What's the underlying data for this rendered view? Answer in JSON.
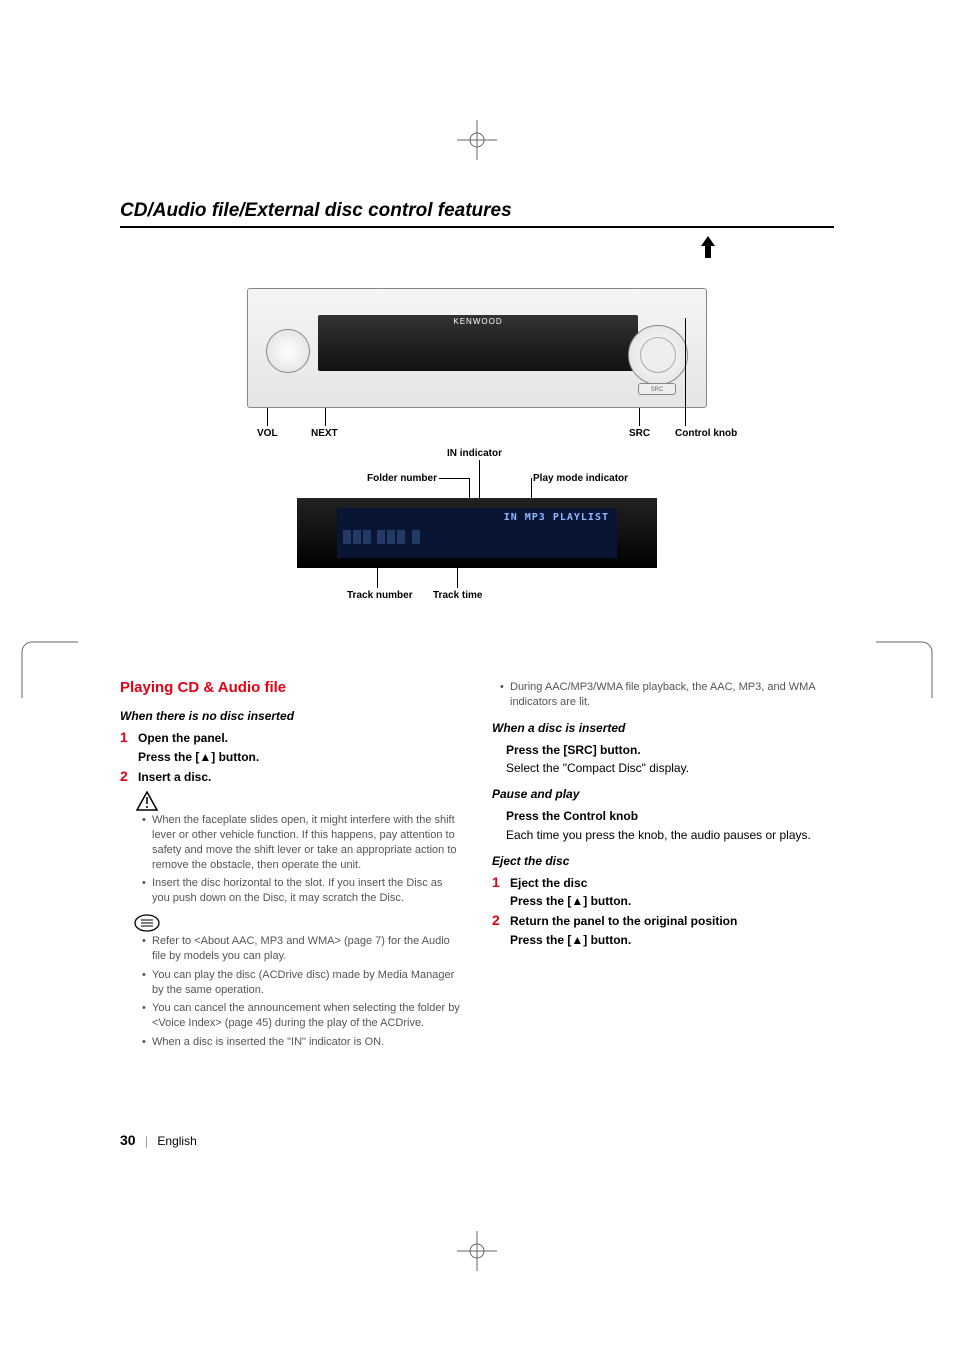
{
  "section_title": "CD/Audio file/External disc control features",
  "diagram": {
    "kenwood": "KENWOOD",
    "src": "SRC",
    "labels": {
      "vol": "VOL",
      "next": "NEXT",
      "src": "SRC",
      "control_knob": "Control knob",
      "in_indicator": "IN indicator",
      "folder_number": "Folder number",
      "play_mode_indicator": "Play mode indicator",
      "track_number": "Track number",
      "track_time": "Track time"
    },
    "lcd_text": "IN MP3 PLAYLIST"
  },
  "left": {
    "heading": "Playing CD & Audio file",
    "sub1": "When there is no disc inserted",
    "step1": {
      "num": "1",
      "title": "Open the panel.",
      "sub": "Press the [▲] button."
    },
    "step2": {
      "num": "2",
      "title": "Insert a disc."
    },
    "warn": [
      "When the faceplate slides open, it might interfere with the shift lever or other vehicle function. If this happens, pay attention to safety and move the shift lever or take an appropriate action to remove the obstacle, then operate the unit.",
      "Insert the disc horizontal to the slot. If you insert the Disc as you push down on the Disc, it may scratch the Disc."
    ],
    "info": [
      "Refer to <About AAC, MP3 and WMA> (page 7) for the Audio file by models you can play.",
      "You can play the disc (ACDrive disc) made by Media Manager by the same operation.",
      "You can cancel the announcement when selecting the folder by <Voice Index> (page 45) during the play of the ACDrive.",
      "When a disc is inserted the \"IN\" indicator is ON."
    ]
  },
  "right": {
    "info_top": [
      "During AAC/MP3/WMA file playback, the AAC, MP3, and WMA indicators are lit."
    ],
    "sub2": "When a disc is inserted",
    "sub2_title": "Press the [SRC] button.",
    "sub2_body": "Select the \"Compact Disc\" display.",
    "sub3": "Pause and play",
    "sub3_title": "Press the Control knob",
    "sub3_body": "Each time you press the knob, the audio pauses or plays.",
    "sub4": "Eject the disc",
    "step1": {
      "num": "1",
      "title": "Eject the disc",
      "sub": "Press the [▲] button."
    },
    "step2": {
      "num": "2",
      "title": "Return the panel to the original position",
      "sub": "Press the [▲] button."
    }
  },
  "footer": {
    "page": "30",
    "lang": "English"
  }
}
